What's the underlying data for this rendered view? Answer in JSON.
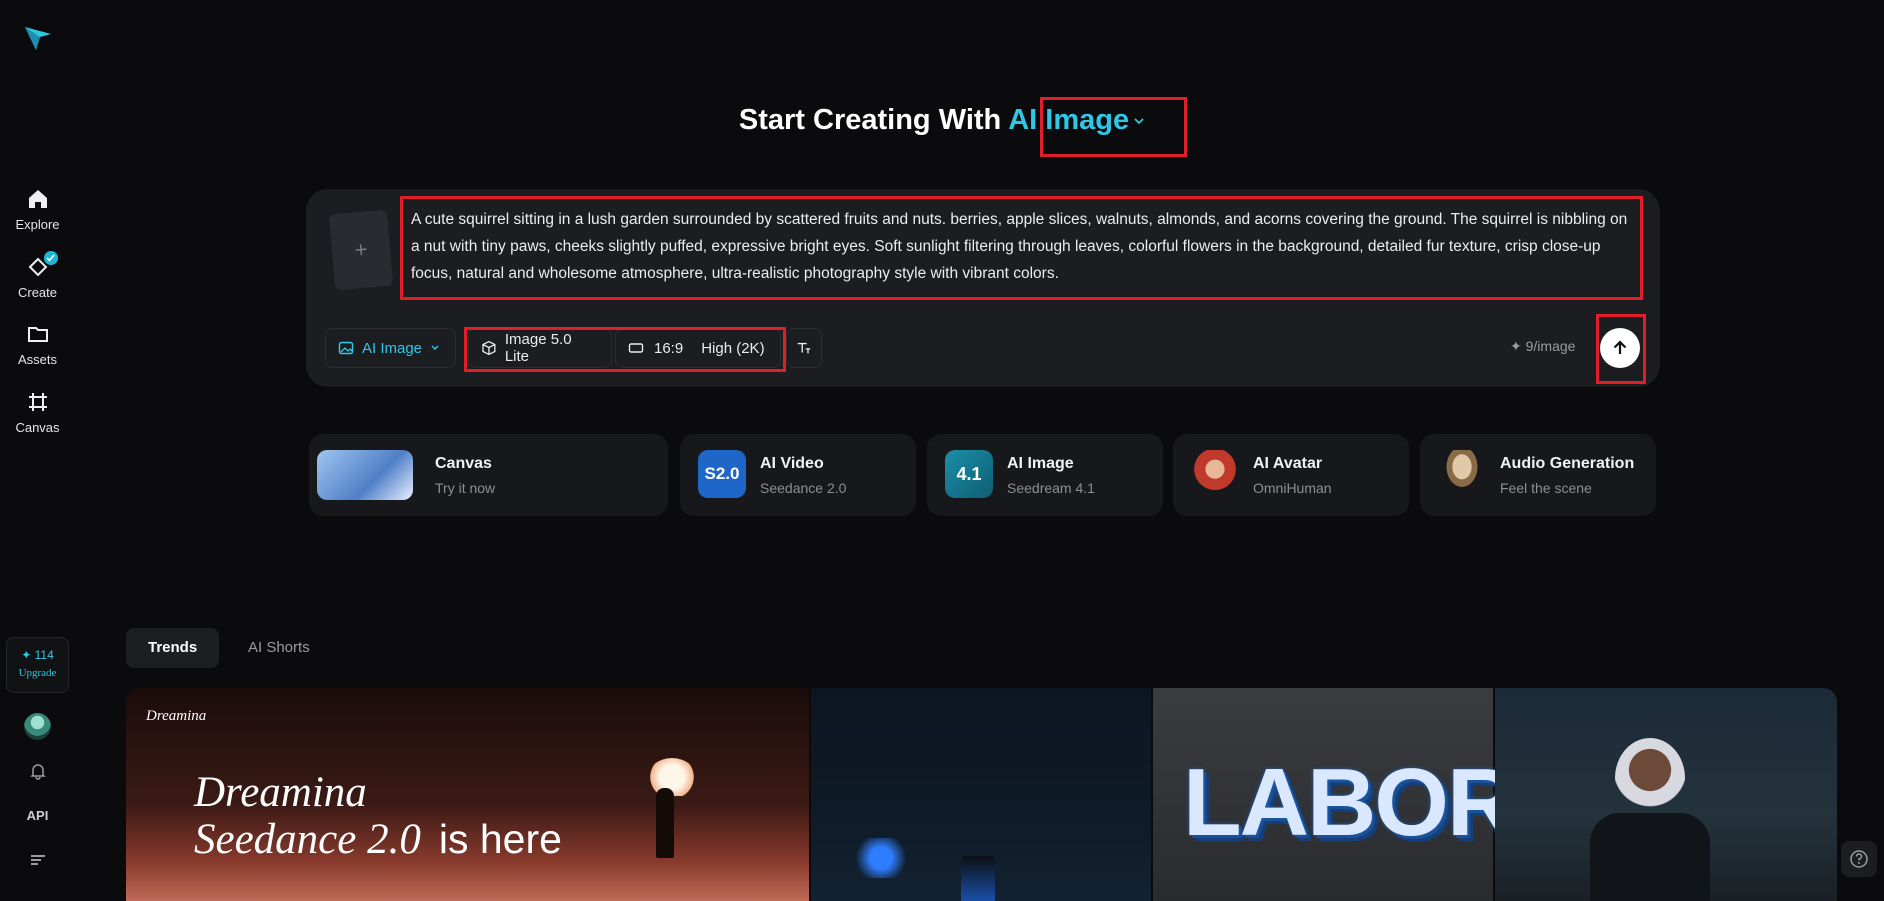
{
  "sidebar": {
    "items": [
      {
        "label": "Explore",
        "icon": "home-icon"
      },
      {
        "label": "Create",
        "icon": "create-icon"
      },
      {
        "label": "Assets",
        "icon": "folder-icon"
      },
      {
        "label": "Canvas",
        "icon": "canvas-icon"
      }
    ],
    "credits": {
      "value": "✦ 114",
      "upgrade_label": "Upgrade"
    },
    "api_label": "API"
  },
  "heading": {
    "prefix": "Start Creating With",
    "mode": "AI Image"
  },
  "prompt": {
    "text": "A cute squirrel sitting in a lush garden surrounded by scattered fruits and nuts. berries, apple slices, walnuts, almonds, and acorns covering the ground. The squirrel is nibbling on a nut with tiny paws, cheeks slightly puffed, expressive bright eyes. Soft sunlight filtering through leaves, colorful flowers in the background, detailed fur texture, crisp close-up focus, natural and wholesome atmosphere, ultra-realistic photography style with vibrant colors.",
    "add_reference": "+"
  },
  "toolbar": {
    "mode_label": "AI Image",
    "model_label": "Image 5.0 Lite",
    "ratio_label": "16:9",
    "quality_label": "High (2K)",
    "cost_label": "✦ 9/image"
  },
  "features": [
    {
      "title": "Canvas",
      "subtitle": "Try it now"
    },
    {
      "title": "AI Video",
      "subtitle": "Seedance 2.0",
      "badge": "S2.0"
    },
    {
      "title": "AI Image",
      "subtitle": "Seedream 4.1",
      "badge": "4.1"
    },
    {
      "title": "AI Avatar",
      "subtitle": "OmniHuman"
    },
    {
      "title": "Audio Generation",
      "subtitle": "Feel the scene"
    }
  ],
  "tabs": [
    {
      "label": "Trends",
      "active": true
    },
    {
      "label": "AI Shorts",
      "active": false
    }
  ],
  "gallery": {
    "brand": "Dreamina",
    "promo_line1": "Dreamina",
    "promo_line2": "Seedance 2.0",
    "promo_line2_suffix": "is here",
    "labor_text": "LABOR"
  },
  "colors": {
    "accent": "#2ec8e6",
    "highlight": "#e01f2b",
    "background": "#0b0b0d"
  }
}
